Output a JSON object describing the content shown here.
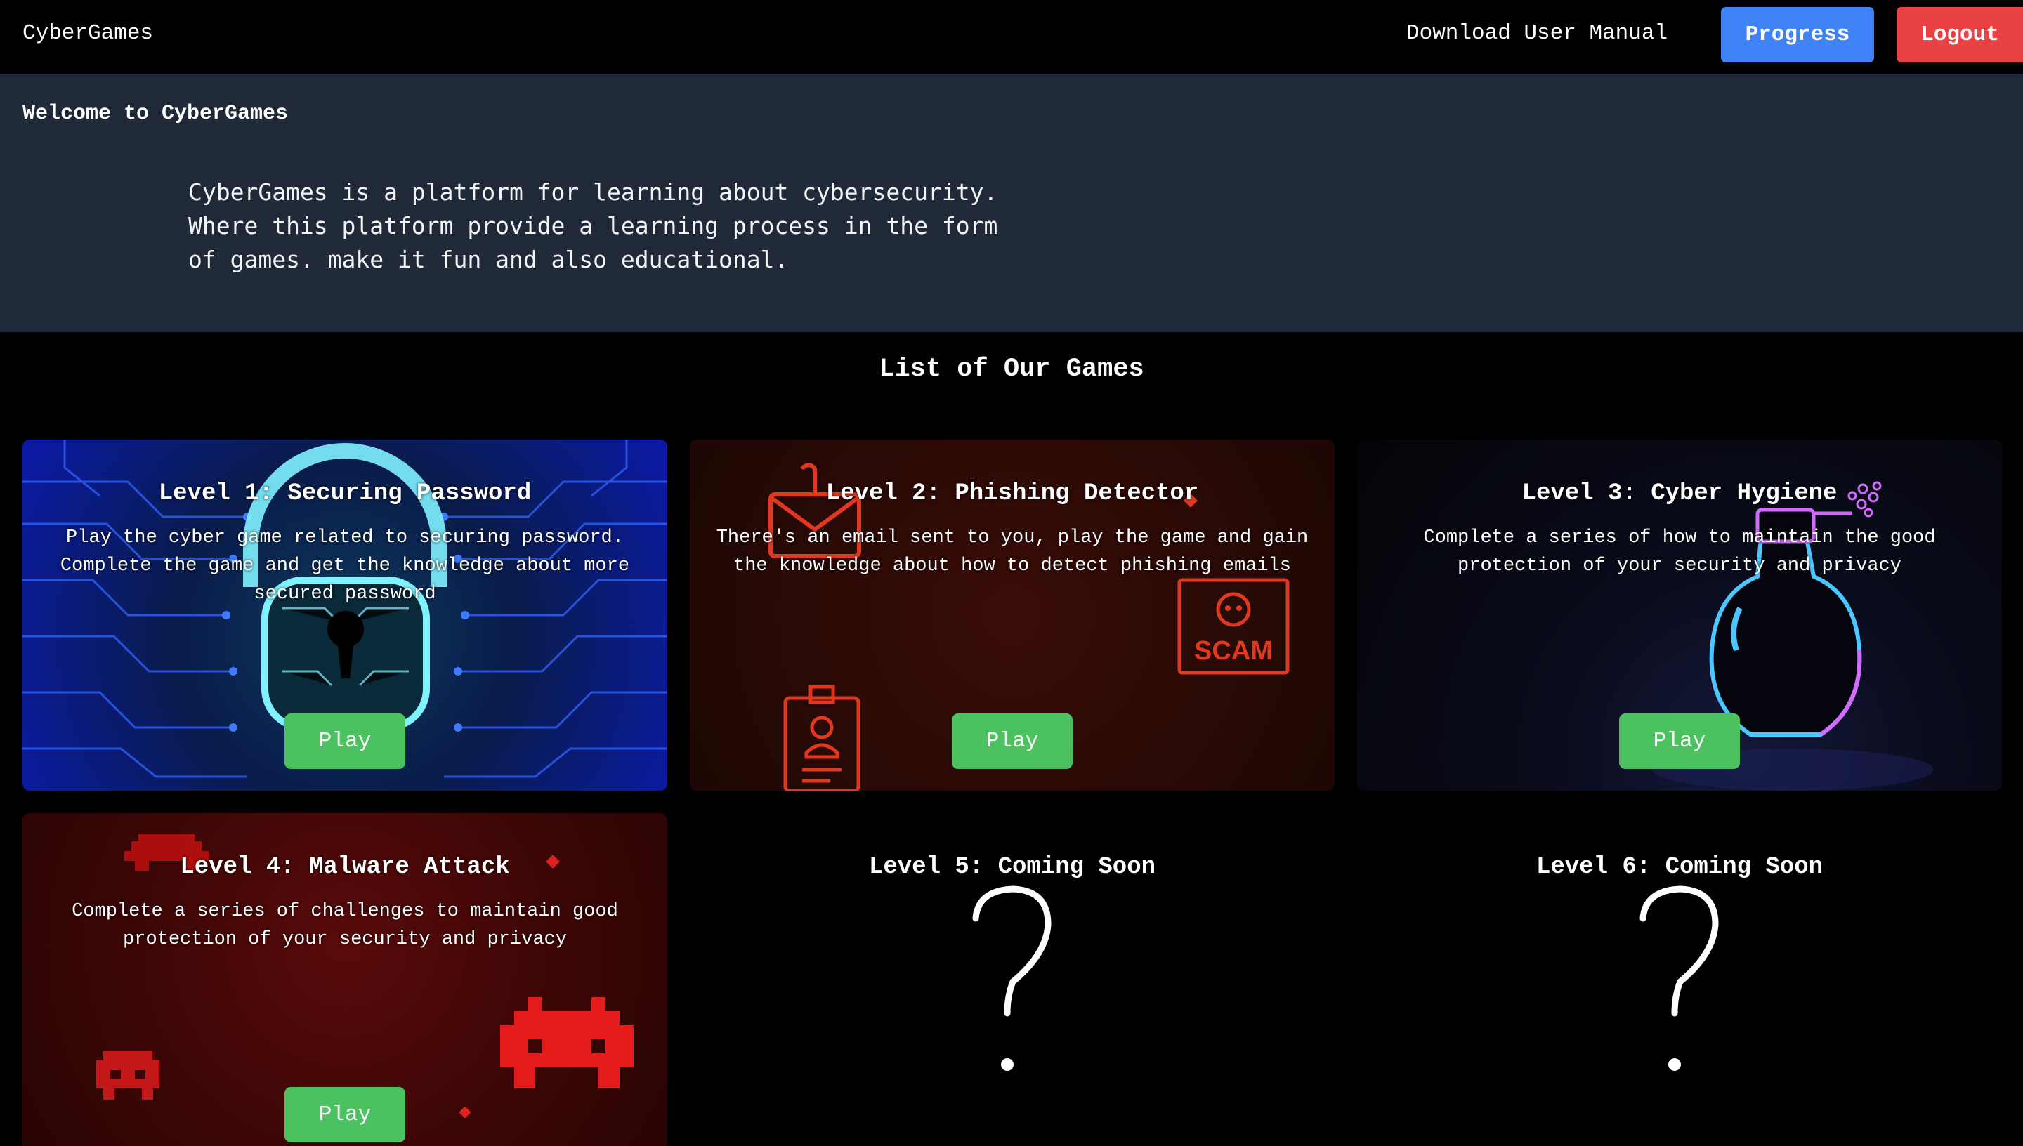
{
  "navbar": {
    "brand": "CyberGames",
    "manual_link": "Download User Manual",
    "progress_label": "Progress",
    "logout_label": "Logout",
    "colors": {
      "progress": "#3f82f6",
      "logout": "#ea4144"
    }
  },
  "welcome": {
    "title": "Welcome to CyberGames",
    "text": "CyberGames is a platform for learning about cybersecurity. Where this platform provide a learning process in the form of games. make it fun and also educational."
  },
  "games_section": {
    "title": "List of Our Games",
    "play_color": "#4bc25f",
    "games": [
      {
        "title": "Level 1: Securing Password",
        "description": "Play the cyber game related to securing password. Complete the game and get the knowledge about more secured password",
        "play_label": "Play",
        "icon": "padlock-icon"
      },
      {
        "title": "Level 2: Phishing Detector",
        "description": "There's an email sent to you, play the game and gain the knowledge about how to detect phishing emails",
        "play_label": "Play",
        "icon": "phishing-mail-icon",
        "scam_badge": "SCAM"
      },
      {
        "title": "Level 3: Cyber Hygiene",
        "description": "Complete a series of how to maintain the good protection of your security and privacy",
        "play_label": "Play",
        "icon": "spray-bottle-icon"
      },
      {
        "title": "Level 4: Malware Attack",
        "description": "Complete a series of challenges to maintain good protection of your security and privacy",
        "play_label": "Play",
        "icon": "space-invader-icon"
      },
      {
        "title": "Level 5: Coming Soon",
        "icon": "question-mark-icon"
      },
      {
        "title": "Level 6: Coming Soon",
        "icon": "question-mark-icon"
      }
    ]
  }
}
